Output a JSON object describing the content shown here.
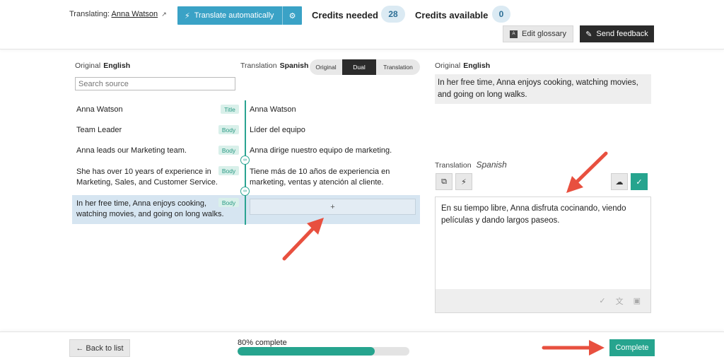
{
  "header": {
    "translating_label": "Translating:",
    "translating_name": "Anna Watson",
    "translate_button": "Translate automatically",
    "credits_needed_label": "Credits needed",
    "credits_needed_value": "28",
    "credits_available_label": "Credits available",
    "credits_available_value": "0",
    "edit_glossary": "Edit glossary",
    "send_feedback": "Send feedback"
  },
  "left": {
    "original_label": "Original",
    "original_lang": "English",
    "translation_label": "Translation",
    "translation_lang": "Spanish",
    "view_modes": [
      "Original",
      "Dual",
      "Translation"
    ],
    "active_view_mode": "Dual",
    "search_placeholder": "Search source",
    "add_symbol": "+",
    "rows": [
      {
        "source": "Anna Watson",
        "tag": "Title",
        "translation": "Anna Watson"
      },
      {
        "source": "Team Leader",
        "tag": "Body",
        "translation": "Líder del equipo"
      },
      {
        "source": "Anna leads our Marketing team.",
        "tag": "Body",
        "translation": "Anna dirige nuestro equipo de marketing."
      },
      {
        "source": "She has over 10 years of experience in Marketing, Sales, and Customer Service.",
        "tag": "Body",
        "translation": "Tiene más de 10 años de experiencia en marketing, ventas y atención al cliente."
      },
      {
        "source": "In her free time, Anna enjoys cooking, watching movies, and going on long walks.",
        "tag": "Body",
        "translation": ""
      }
    ]
  },
  "right": {
    "original_label": "Original",
    "original_lang": "English",
    "original_text": "In her free time, Anna enjoys cooking, watching movies, and going on long walks.",
    "translation_label": "Translation",
    "translation_lang": "Spanish",
    "translation_text": "En su tiempo libre, Anna disfruta cocinando, viendo películas y dando largos paseos."
  },
  "footer": {
    "back_button": "← Back to list",
    "progress_label": "80% complete",
    "progress_value": 0.8,
    "complete_button": "Complete"
  },
  "colors": {
    "accent_teal": "#26a48e",
    "translate_blue": "#3aa2c6",
    "arrow_red": "#e8503f",
    "selected_row": "#d6e5f1"
  },
  "icons": [
    "external-link-icon",
    "lightning-icon",
    "gear-icon",
    "glossary-icon",
    "pencil-icon",
    "link-icon",
    "copy-icon",
    "cloud-upload-icon",
    "check-icon",
    "spellcheck-icon",
    "translate-icon",
    "dictionary-icon"
  ]
}
